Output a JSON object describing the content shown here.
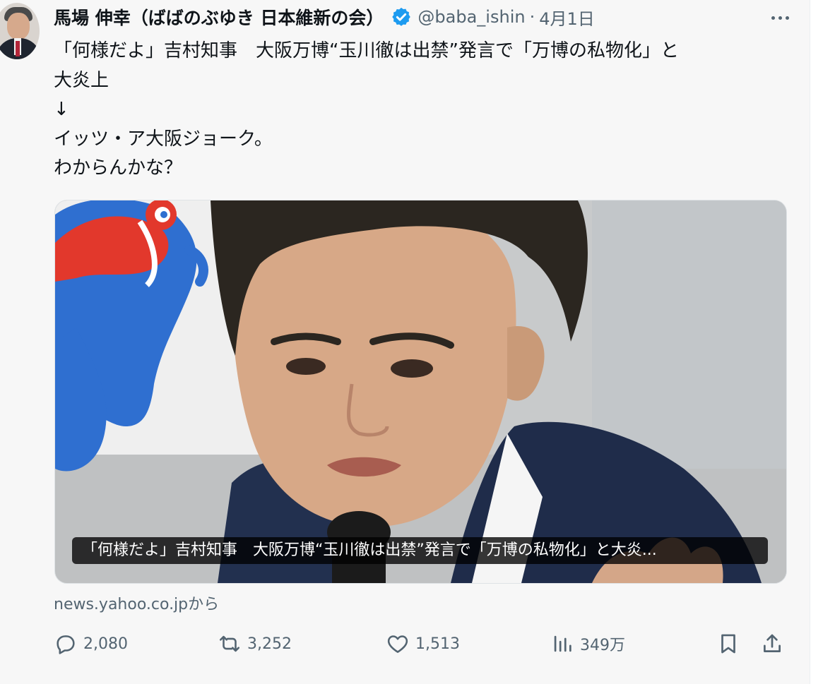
{
  "post": {
    "display_name": "馬場 伸幸（ばばのぶゆき 日本維新の会）",
    "handle": "@baba_ishin",
    "separator": "·",
    "date": "4月1日",
    "text_lines": [
      "「何様だよ」吉村知事　大阪万博“玉川徹は出禁”発言で「万博の私物化」と",
      "大炎上",
      "↓",
      "イッツ・ア大阪ジョーク。",
      "わからんかな？"
    ]
  },
  "card": {
    "caption": "「何様だよ」吉村知事　大阪万博“玉川徹は出禁”発言で「万博の私物化」と大炎...",
    "source": "news.yahoo.co.jpから"
  },
  "actions": {
    "replies": "2,080",
    "reposts": "3,252",
    "likes": "1,513",
    "views": "349万"
  },
  "icons": {
    "verified": "verified-badge-icon",
    "more": "more-icon",
    "reply": "reply-icon",
    "repost": "repost-icon",
    "like": "heart-icon",
    "views": "views-icon",
    "bookmark": "bookmark-icon",
    "share": "share-icon"
  },
  "colors": {
    "verified": "#1d9bf0",
    "text": "#0f1419",
    "secondary": "#536471"
  }
}
